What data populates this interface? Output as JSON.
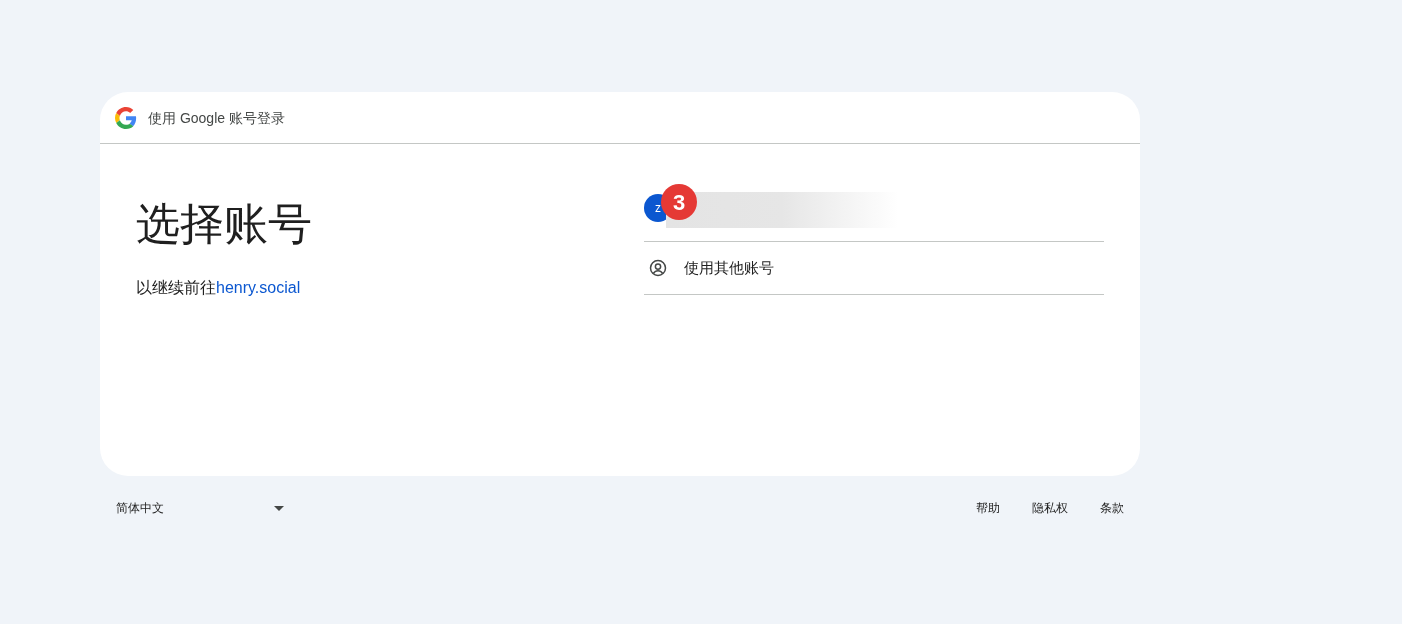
{
  "header": {
    "title": "使用 Google 账号登录"
  },
  "heading": "选择账号",
  "subtitle": {
    "text": "以继续前往",
    "link": "henry.social"
  },
  "accounts": [
    {
      "kind": "account",
      "avatar": "z",
      "badge": "3"
    },
    {
      "kind": "other",
      "label": "使用其他账号"
    }
  ],
  "footer": {
    "language": "简体中文",
    "links": [
      "帮助",
      "隐私权",
      "条款"
    ]
  }
}
